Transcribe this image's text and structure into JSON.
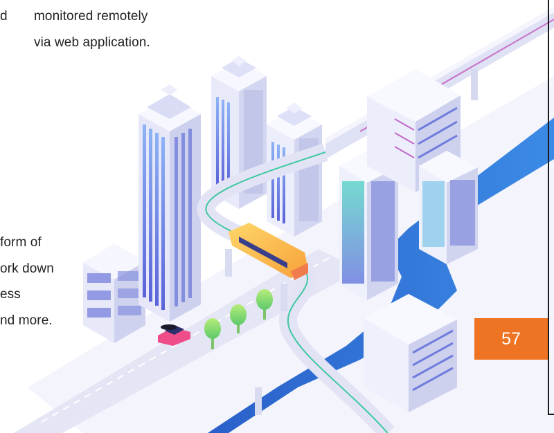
{
  "text_fragments": {
    "top_left_clip": "d",
    "top_right_line1": "monitored remotely",
    "top_right_line2": "via web application.",
    "left_line1": "form of",
    "left_line2": "ork down",
    "left_line3": "ess",
    "left_line4": "nd more."
  },
  "page_number": "57",
  "colors": {
    "accent": "#ee7424",
    "river": "#2d6fd6",
    "building": "#e6e7f8",
    "glass": "#6f83e6"
  }
}
